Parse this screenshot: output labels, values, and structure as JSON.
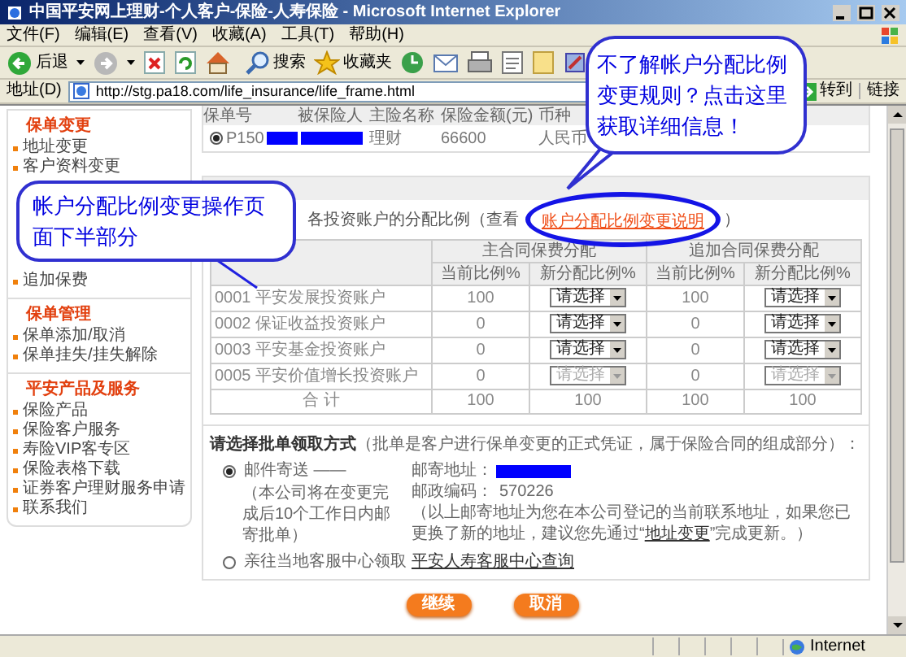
{
  "window": {
    "title": "中国平安网上理财-个人客户-保险-人寿保险 - Microsoft Internet Explorer"
  },
  "menu": [
    "文件(F)",
    "编辑(E)",
    "查看(V)",
    "收藏(A)",
    "工具(T)",
    "帮助(H)"
  ],
  "toolbar": {
    "back": "后退",
    "search": "搜索",
    "favorites": "收藏夹"
  },
  "address_bar": {
    "label": "地址(D)",
    "url": "http://stg.pa18.com/life_insurance/life_frame.html",
    "go": "转到",
    "links": "链接"
  },
  "sidebar": [
    {
      "title": "保单变更",
      "items": [
        "地址变更",
        "客户资料变更"
      ],
      "items_after": [
        "追加保费"
      ]
    },
    {
      "title": "保单管理",
      "items": [
        "保单添加/取消",
        "保单挂失/挂失解除"
      ]
    },
    {
      "title": "平安产品及服务",
      "items": [
        "保险产品",
        "保险客户服务",
        "寿险VIP客专区",
        "保险表格下载",
        "证券客户理财服务申请",
        "联系我们"
      ]
    }
  ],
  "policy_table": {
    "columns": [
      "保单号",
      "被保险人",
      "主险名称",
      "保险金额(元)",
      "币种"
    ],
    "rows": [
      {
        "selected": true,
        "policy_no": "P150",
        "product": "理财",
        "amount": "66600",
        "currency": "人民币"
      }
    ]
  },
  "allocation": {
    "intro": "各投资账户的分配比例（查看",
    "link": "账户分配比例变更说明",
    "intro_end": "）",
    "groups": [
      "主合同保费分配",
      "追加合同保费分配"
    ],
    "subcolumns": [
      "当前比例%",
      "新分配比例%",
      "当前比例%",
      "新分配比例%"
    ],
    "rows": [
      {
        "account": "0001 平安发展投资账户",
        "main_current": "100",
        "main_new": {
          "value": "请选择",
          "disabled": false
        },
        "extra_current": "100",
        "extra_new": {
          "value": "请选择",
          "disabled": false
        }
      },
      {
        "account": "0002 保证收益投资账户",
        "main_current": "0",
        "main_new": {
          "value": "请选择",
          "disabled": false
        },
        "extra_current": "0",
        "extra_new": {
          "value": "请选择",
          "disabled": false
        }
      },
      {
        "account": "0003 平安基金投资账户",
        "main_current": "0",
        "main_new": {
          "value": "请选择",
          "disabled": false
        },
        "extra_current": "0",
        "extra_new": {
          "value": "请选择",
          "disabled": false
        }
      },
      {
        "account": "0005 平安价值增长投资账户",
        "main_current": "0",
        "main_new": {
          "value": "请选择",
          "disabled": true
        },
        "extra_current": "0",
        "extra_new": {
          "value": "请选择",
          "disabled": true
        }
      }
    ],
    "total": [
      "合 计",
      "100",
      "100",
      "100",
      "100"
    ]
  },
  "receipt": {
    "title": "请选择批单领取方式",
    "title_note": "（批单是客户进行保单变更的正式凭证，属于保险合同的组成部分）：",
    "options": [
      {
        "label": "邮件寄送 ——",
        "selected": true,
        "note": "（本公司将在变更完成后10个工作日内邮寄批单）"
      },
      {
        "label": "亲往当地客服中心领取",
        "selected": false
      }
    ],
    "address_label": "邮寄地址：",
    "zip_label": "邮政编码：",
    "zip": "570226",
    "notice": "（以上邮寄地址为您在本公司登记的当前联系地址，如果您已更换了新的地址，建议您先通过“",
    "notice_link": "地址变更",
    "notice_end": "”完成更新。）",
    "service_link": "平安人寿客服中心查询"
  },
  "buttons": [
    "继续",
    "取消"
  ],
  "status_bar": {
    "zone": "Internet"
  },
  "callouts": [
    {
      "text": "不了解帐户分配比例变更规则？点击这里获取详细信息！"
    },
    {
      "text": "帐户分配比例变更操作页面下半部分"
    }
  ]
}
